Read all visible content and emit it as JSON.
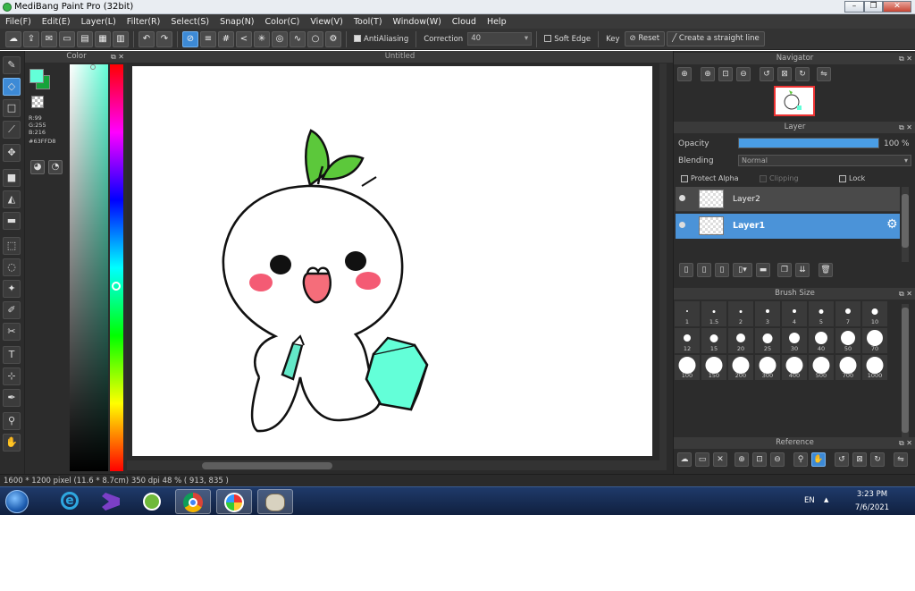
{
  "window": {
    "title": "MediBang Paint Pro (32bit)"
  },
  "menu": [
    "File(F)",
    "Edit(E)",
    "Layer(L)",
    "Filter(R)",
    "Select(S)",
    "Snap(N)",
    "Color(C)",
    "View(V)",
    "Tool(T)",
    "Window(W)",
    "Cloud",
    "Help"
  ],
  "toolbar": {
    "antialiasing_label": "AntiAliasing",
    "correction_label": "Correction",
    "correction_value": "40",
    "soft_edge_label": "Soft Edge",
    "key_label": "Key",
    "reset_label": "Reset",
    "straight_line_label": "Create a straight line"
  },
  "color_panel": {
    "title": "Color",
    "r": "R:99",
    "g": "G:255",
    "b": "B:216",
    "hex": "#63FFD8",
    "fg_color": "#63ffd8",
    "bg_color": "#16a33a"
  },
  "document": {
    "tab_title": "Untitled"
  },
  "navigator": {
    "title": "Navigator"
  },
  "layer_panel": {
    "title": "Layer",
    "opacity_label": "Opacity",
    "opacity_value": "100 %",
    "opacity_fraction": 1.0,
    "blending_label": "Blending",
    "blending_value": "Normal",
    "protect_alpha_label": "Protect Alpha",
    "clipping_label": "Clipping",
    "lock_label": "Lock",
    "layers": [
      {
        "name": "Layer2",
        "selected": false
      },
      {
        "name": "Layer1",
        "selected": true
      }
    ]
  },
  "brush_size": {
    "title": "Brush Size",
    "sizes": [
      "1",
      "1.5",
      "2",
      "3",
      "4",
      "5",
      "7",
      "10",
      "12",
      "15",
      "20",
      "25",
      "30",
      "40",
      "50",
      "70",
      "100",
      "150",
      "200",
      "300",
      "400",
      "500",
      "700",
      "1000"
    ]
  },
  "reference": {
    "title": "Reference"
  },
  "status": {
    "text": "1600 * 1200 pixel   (11.6 * 8.7cm)  350 dpi  48 %  ( 913, 835 )"
  },
  "taskbar": {
    "lang": "EN",
    "time": "3:23 PM",
    "date": "7/6/2021"
  }
}
